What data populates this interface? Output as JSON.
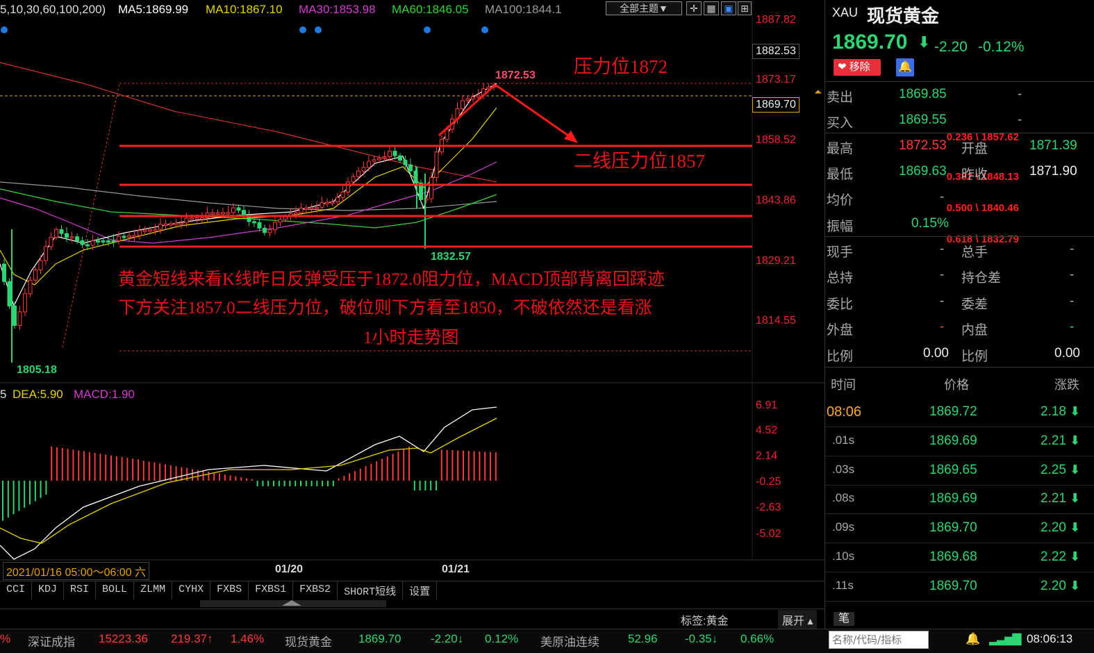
{
  "ma_legend": {
    "params": "5,10,30,60,100,200)",
    "ma5": "MA5:1869.99",
    "ma10": "MA10:1867.10",
    "ma30": "MA30:1853.98",
    "ma60": "MA60:1846.05",
    "ma100": "MA100:1844.1"
  },
  "toolbar": {
    "theme_label": "全部主题▼"
  },
  "price_axis": [
    "1887.82",
    "1882.53",
    "1873.17",
    "1869.70",
    "1858.52",
    "1843.86",
    "1829.21",
    "1814.55"
  ],
  "macd_axis": [
    "6.91",
    "4.52",
    "2.14",
    "-0.25",
    "-2.63",
    "-5.02"
  ],
  "chart_labels": {
    "high_mark": "1872.53",
    "low_mark": "1832.57",
    "left_low_mark": "1805.18",
    "fib_0236": "0.236 \\ 1857.62",
    "fib_0382": "0.382 \\ 1848.13",
    "fib_0500": "0.500 \\ 1840.46",
    "fib_0618": "0.618 \\ 1832.79"
  },
  "annotations": {
    "resistance": "压力位1872",
    "second_resistance": "二线压力位1857",
    "line1": "黄金短线来看K线昨日反弹受压于1872.0阻力位，MACD顶部背离回踩迹",
    "line2": "下方关注1857.0二线压力位，破位则下方看至1850，不破依然还是看涨",
    "line3": "1小时走势图"
  },
  "macd_legend": {
    "prefix": "5",
    "dea": "DEA:5.90",
    "macd": "MACD:1.90"
  },
  "date_axis": {
    "cursor": "2021/01/16 05:00～06:00 六",
    "d1": "01/20",
    "d2": "01/21"
  },
  "indicator_tabs": [
    "CCI",
    "KDJ",
    "RSI",
    "BOLL",
    "ZLMM",
    "CYHX",
    "FXBS",
    "FXBS1",
    "FXBS2",
    "SHORT短线",
    "设置"
  ],
  "label_bar": {
    "tag": "标签:黄金",
    "expand": "展开 ▴"
  },
  "quote": {
    "symbol": "XAU",
    "name": "现货黄金",
    "price": "1869.70",
    "arrow": "⬇",
    "change": "-2.20",
    "pct": "-0.12%",
    "remove_btn": "移除",
    "sell_label": "卖出",
    "sell": "1869.85",
    "sell_vol": "-",
    "buy_label": "买入",
    "buy": "1869.55",
    "buy_vol": "-",
    "high_label": "最高",
    "high": "1872.53",
    "open_label": "开盘",
    "open": "1871.39",
    "low_label": "最低",
    "low": "1869.63",
    "prev_label": "昨收",
    "prev": "1871.90",
    "avg_label": "均价",
    "avg": "-",
    "amp_label": "振幅",
    "amp": "0.15%",
    "cur_vol_label": "现手",
    "cur_vol": "-",
    "total_vol_label": "总手",
    "total_vol": "-",
    "hold_label": "总持",
    "hold": "-",
    "hold_diff_label": "持仓差",
    "hold_diff": "-",
    "weibi_label": "委比",
    "weibi": "-",
    "weicha_label": "委差",
    "weicha": "-",
    "outer_label": "外盘",
    "outer": "-",
    "inner_label": "内盘",
    "inner": "-",
    "ratio1_label": "比例",
    "ratio1": "0.00",
    "ratio2_label": "比例",
    "ratio2": "0.00"
  },
  "ticks_header": {
    "time": "时间",
    "price": "价格",
    "change": "涨跌"
  },
  "ticks": [
    {
      "time": "08:06",
      "price": "1869.72",
      "change": "2.18"
    },
    {
      "time": ".01s",
      "price": "1869.69",
      "change": "2.21"
    },
    {
      "time": ".03s",
      "price": "1869.65",
      "change": "2.25"
    },
    {
      "time": ".08s",
      "price": "1869.69",
      "change": "2.21"
    },
    {
      "time": ".09s",
      "price": "1869.70",
      "change": "2.20"
    },
    {
      "time": ".10s",
      "price": "1869.68",
      "change": "2.22"
    },
    {
      "time": ".11s",
      "price": "1869.70",
      "change": "2.20"
    }
  ],
  "ticks_tab": "笔",
  "search": {
    "placeholder": "名称/代码/指标"
  },
  "status_bar": {
    "pct0": "%",
    "szcz_name": "深证成指",
    "szcz_val": "15223.36",
    "szcz_chg": "219.37↑",
    "szcz_pct": "1.46%",
    "gold_name": "现货黄金",
    "gold_val": "1869.70",
    "gold_chg": "-2.20↓",
    "gold_pct": "0.12%",
    "oil_name": "美原油连续",
    "oil_val": "52.96",
    "oil_chg": "-0.35↓",
    "oil_pct": "0.66%",
    "clock": "08:06:13"
  },
  "colors": {
    "up": "#ff3b3b",
    "down": "#2ed573",
    "annotation": "#e8141a",
    "ma5": "#ffffff",
    "ma10": "#e6d400",
    "ma30": "#d43bd4",
    "ma60": "#2fd82f",
    "ma100": "#9a9a9a"
  }
}
